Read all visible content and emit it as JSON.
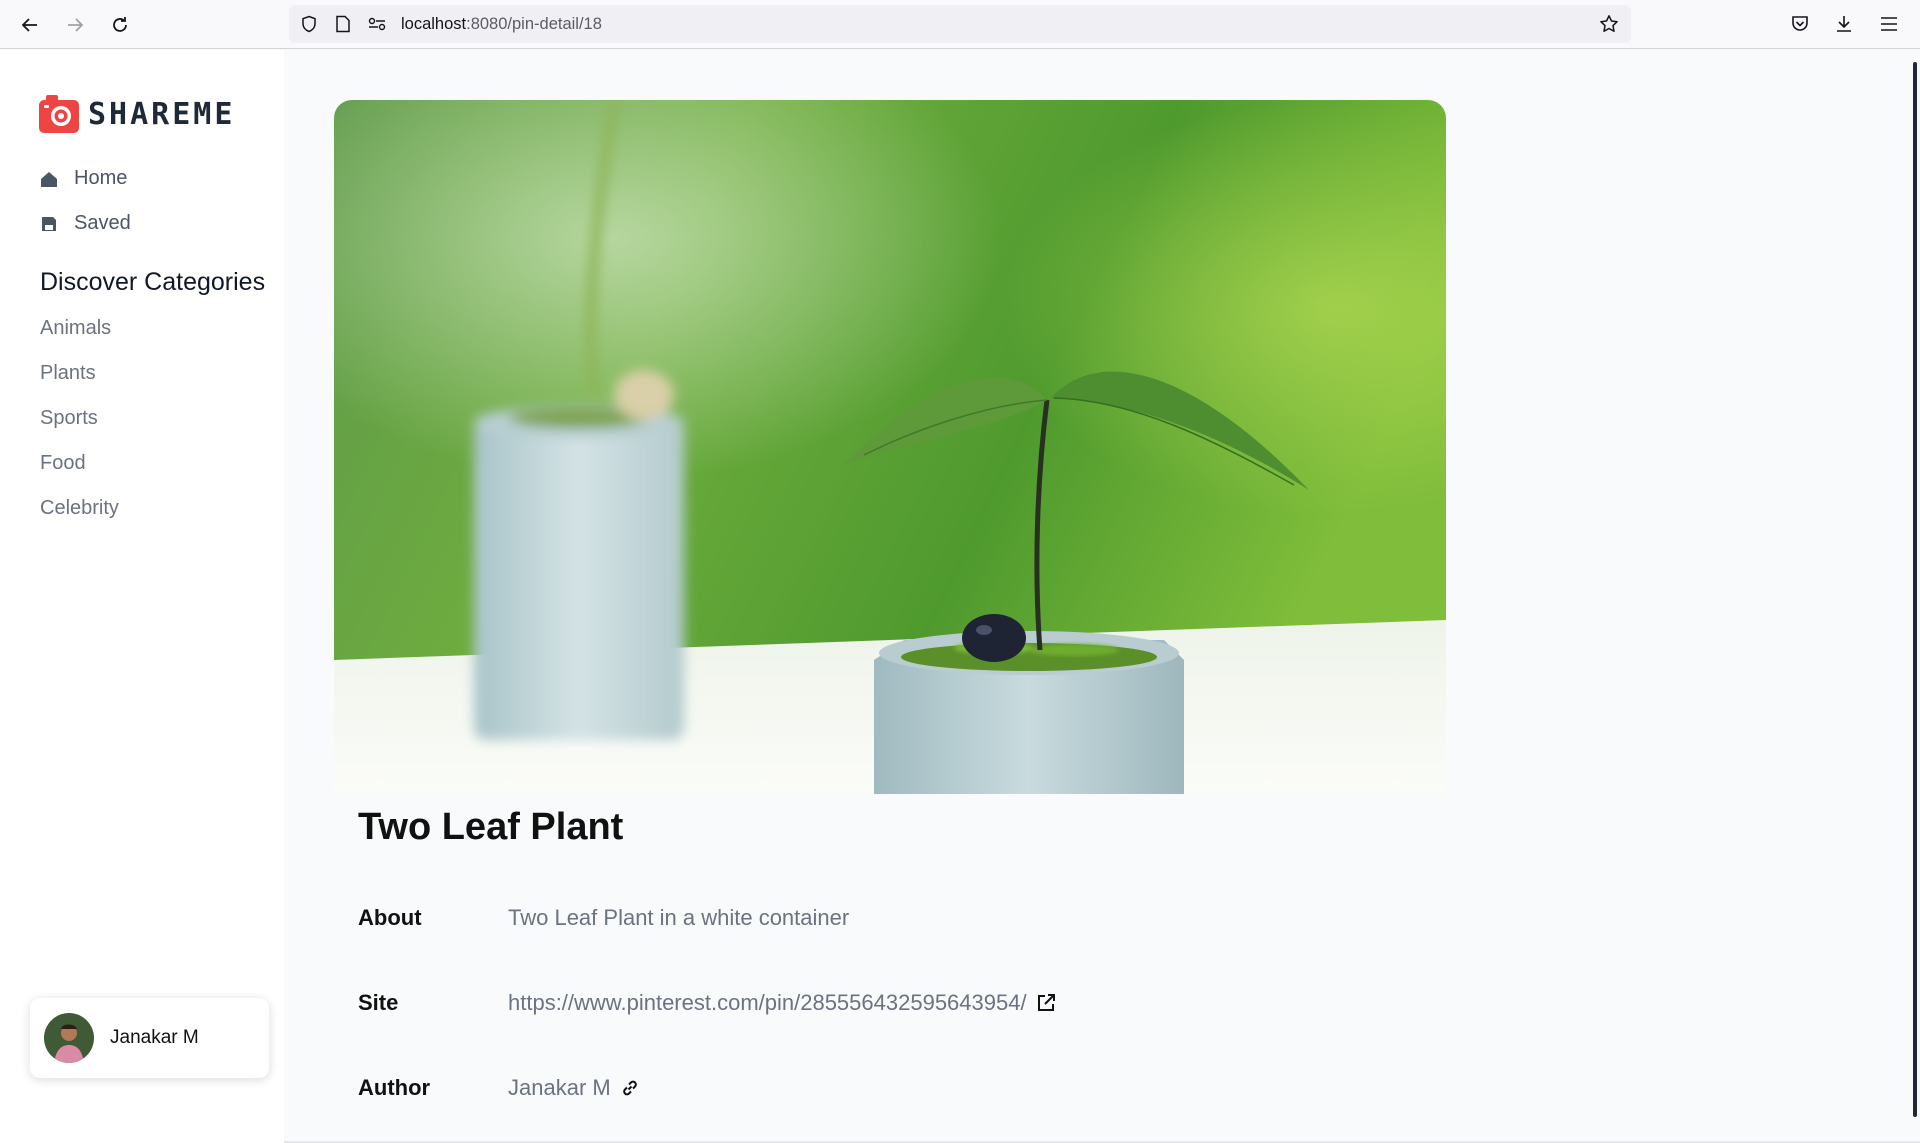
{
  "browser": {
    "url_host": "localhost",
    "url_rest": ":8080/pin-detail/18",
    "icons": [
      "back-arrow-icon",
      "forward-arrow-icon",
      "reload-icon",
      "shield-icon",
      "page-icon",
      "site-permissions-icon",
      "bookmark-star-icon",
      "pocket-icon",
      "download-icon",
      "menu-icon"
    ]
  },
  "sidebar": {
    "logo_text": "SHAREME",
    "nav": [
      {
        "label": "Home",
        "icon": "home-icon"
      },
      {
        "label": "Saved",
        "icon": "save-icon"
      }
    ],
    "discover_title": "Discover Categories",
    "categories": [
      "Animals",
      "Plants",
      "Sports",
      "Food",
      "Celebrity"
    ],
    "user": {
      "name": "Janakar M"
    }
  },
  "pin": {
    "title": "Two Leaf Plant",
    "about_label": "About",
    "about_value": "Two Leaf Plant in a white container",
    "site_label": "Site",
    "site_value": "https://www.pinterest.com/pin/285556432595643954/",
    "author_label": "Author",
    "author_value": "Janakar M"
  },
  "colors": {
    "accent": "#ef4444",
    "text_muted": "#6b7280",
    "sidebar_bg": "#ffffff",
    "page_bg": "#f9fafb"
  }
}
